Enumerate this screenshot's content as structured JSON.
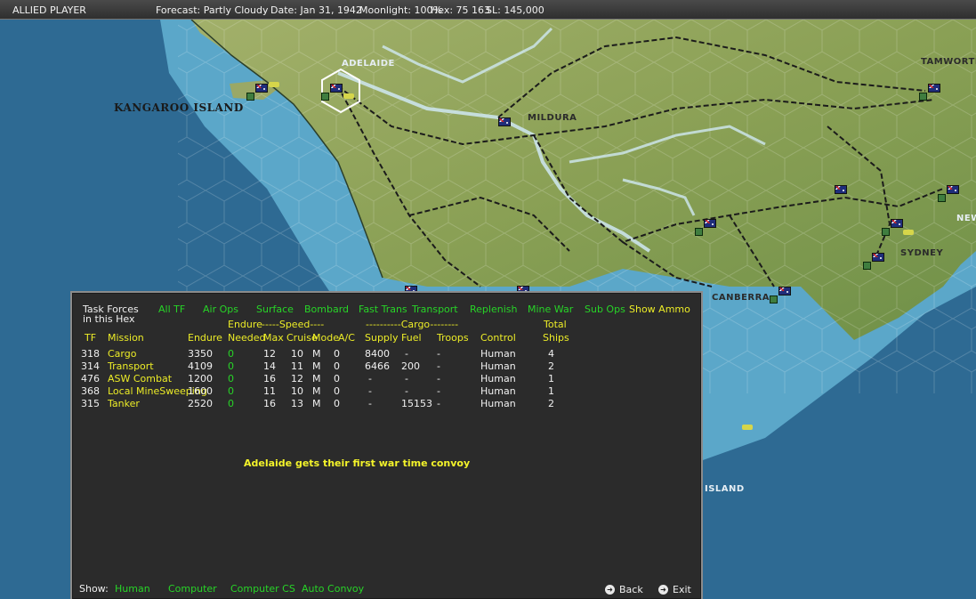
{
  "topbar": {
    "player": "ALLIED PLAYER",
    "forecast": "Forecast: Partly Cloudy",
    "date": "Date: Jan 31, 1942",
    "moonlight": "Moonlight: 100%",
    "hex": "Hex: 75 163",
    "sl": "SL: 145,000"
  },
  "map": {
    "places": {
      "adelaide": "ADELAIDE",
      "kangaroo_island": "KANGAROO ISLAND",
      "mildura": "MILDURA",
      "tamworth": "TAMWORTH",
      "canberra": "CANBERRA",
      "sydney": "SYDNEY",
      "new": "NEW",
      "island": "ISLAND"
    },
    "colors": {
      "sea": "#2e6a93",
      "shallow": "#5ba7c9",
      "land": "#8fa35a",
      "river": "#cfe8f2"
    }
  },
  "panel": {
    "title_line1": "Task Forces",
    "title_line2": "in this Hex",
    "filters": [
      "All TF",
      "Air Ops",
      "Surface",
      "Bombard",
      "Fast Trans",
      "Transport",
      "Replenish",
      "Mine War",
      "Sub Ops"
    ],
    "show_ammo": "Show Ammo",
    "group_headers": {
      "endure": "Endure",
      "speed": "-----Speed----",
      "cargo": "----------Cargo--------",
      "total": "Total"
    },
    "columns": {
      "tf": "TF",
      "mission": "Mission",
      "endure": "Endure",
      "needed": "Needed",
      "max": "Max",
      "cruise": "Cruise",
      "mode": "Mode",
      "ac": "A/C",
      "supply": "Supply",
      "fuel": "Fuel",
      "troops": "Troops",
      "control": "Control",
      "ships": "Ships"
    },
    "rows": [
      {
        "tf": "318",
        "mission": "Cargo",
        "endure": "3350",
        "needed": "0",
        "max": "12",
        "cruise": "10",
        "mode": "M",
        "ac": "0",
        "supply": "8400",
        "fuel": "-",
        "troops": "-",
        "control": "Human",
        "ships": "4"
      },
      {
        "tf": "314",
        "mission": "Transport",
        "endure": "4109",
        "needed": "0",
        "max": "14",
        "cruise": "11",
        "mode": "M",
        "ac": "0",
        "supply": "6466",
        "fuel": "200",
        "troops": "-",
        "control": "Human",
        "ships": "2"
      },
      {
        "tf": "476",
        "mission": "ASW Combat",
        "endure": "1200",
        "needed": "0",
        "max": "16",
        "cruise": "12",
        "mode": "M",
        "ac": "0",
        "supply": "-",
        "fuel": "-",
        "troops": "-",
        "control": "Human",
        "ships": "1"
      },
      {
        "tf": "368",
        "mission": "Local MineSweeping",
        "endure": "1600",
        "needed": "0",
        "max": "11",
        "cruise": "10",
        "mode": "M",
        "ac": "0",
        "supply": "-",
        "fuel": "-",
        "troops": "-",
        "control": "Human",
        "ships": "1"
      },
      {
        "tf": "315",
        "mission": "Tanker",
        "endure": "2520",
        "needed": "0",
        "max": "16",
        "cruise": "13",
        "mode": "M",
        "ac": "0",
        "supply": "-",
        "fuel": "15153",
        "troops": "-",
        "control": "Human",
        "ships": "2"
      }
    ],
    "message": "Adelaide gets their first war time convoy",
    "show_label": "Show:",
    "show_options": [
      "Human",
      "Computer",
      "Computer CS",
      "Auto Convoy"
    ],
    "back_label": "Back",
    "exit_label": "Exit"
  }
}
